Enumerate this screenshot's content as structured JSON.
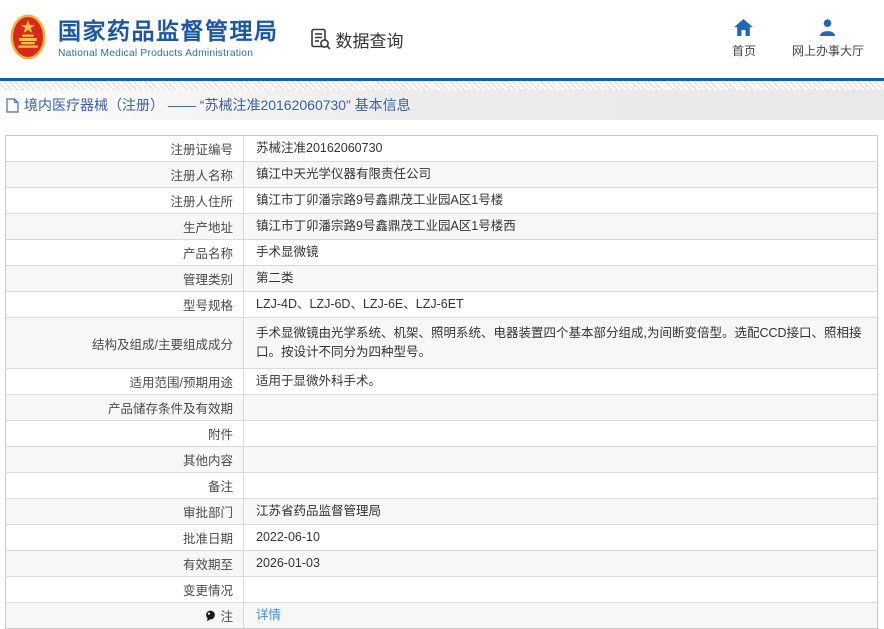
{
  "header": {
    "agency_name": "国家药品监督管理局",
    "agency_name_en": "National Medical Products Administration",
    "data_query_label": "数据查询",
    "nav_home_label": "首页",
    "nav_hall_label": "网上办事大厅"
  },
  "breadcrumb": {
    "text": "境内医疗器械（注册） —— “苏械注准20162060730” 基本信息"
  },
  "table": {
    "rows": [
      {
        "label": "注册证编号",
        "value": "苏械注准20162060730"
      },
      {
        "label": "注册人名称",
        "value": "镇江中天光学仪器有限责任公司"
      },
      {
        "label": "注册人住所",
        "value": "镇江市丁卯潘宗路9号鑫鼎茂工业园A区1号楼"
      },
      {
        "label": "生产地址",
        "value": "镇江市丁卯潘宗路9号鑫鼎茂工业园A区1号楼西"
      },
      {
        "label": "产品名称",
        "value": "手术显微镜"
      },
      {
        "label": "管理类别",
        "value": "第二类"
      },
      {
        "label": "型号规格",
        "value": "LZJ-4D、LZJ-6D、LZJ-6E、LZJ-6ET"
      },
      {
        "label": "结构及组成/主要组成成分",
        "value": "手术显微镜由光学系统、机架、照明系统、电器装置四个基本部分组成,为间断变倍型。选配CCD接口、照相接口。按设计不同分为四种型号。",
        "tall": true
      },
      {
        "label": "适用范围/预期用途",
        "value": "适用于显微外科手术。"
      },
      {
        "label": "产品储存条件及有效期",
        "value": ""
      },
      {
        "label": "附件",
        "value": ""
      },
      {
        "label": "其他内容",
        "value": ""
      },
      {
        "label": "备注",
        "value": ""
      },
      {
        "label": "审批部门",
        "value": "江苏省药品监督管理局"
      },
      {
        "label": "批准日期",
        "value": "2022-06-10"
      },
      {
        "label": "有效期至",
        "value": "2026-01-03"
      },
      {
        "label": "变更情况",
        "value": ""
      },
      {
        "label": "注",
        "value": "详情",
        "link": true,
        "icon": true
      }
    ]
  },
  "colors": {
    "brand_blue": "#1c57a5",
    "icon_blue": "#2268b8",
    "link_blue": "#3e8ddd",
    "header_line_blue": "#1a5caa",
    "emblem_red": "#d6291c",
    "emblem_gold": "#e8b33a",
    "row_alt_bg": "#f7f7f8"
  }
}
